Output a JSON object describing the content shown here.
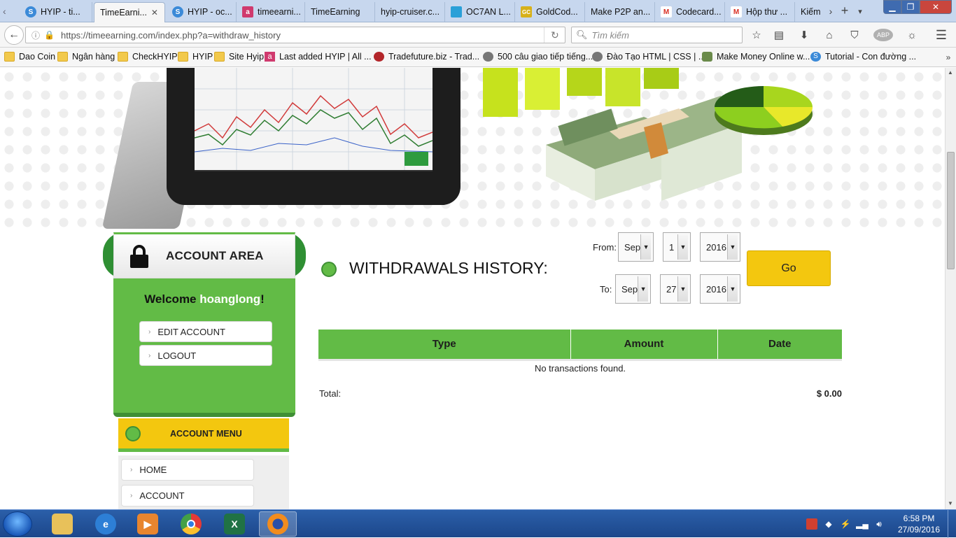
{
  "browser": {
    "tabs": [
      {
        "label": "HYIP - ti...",
        "icon": "s-circle-icon",
        "color": "#3b8ad8"
      },
      {
        "label": "TimeEarni...",
        "active": true,
        "icon": "blank-icon",
        "color": "#ffffff"
      },
      {
        "label": "HYIP - oc...",
        "icon": "s-circle-icon",
        "color": "#3b8ad8"
      },
      {
        "label": "timeearni...",
        "icon": "a-square-icon",
        "color": "#d03a6e"
      },
      {
        "label": "TimeEarning",
        "icon": "blank-icon",
        "color": "transparent"
      },
      {
        "label": "hyip-cruiser.c...",
        "icon": "blank-icon",
        "color": "transparent"
      },
      {
        "label": "OC7AN L...",
        "icon": "flag-icon",
        "color": "#2aa0d8"
      },
      {
        "label": "GoldCod...",
        "icon": "gc-icon",
        "color": "#d7b11a"
      },
      {
        "label": "Make P2P an...",
        "icon": "blank-icon",
        "color": "transparent"
      },
      {
        "label": "Codecard...",
        "icon": "gmail-icon",
        "color": "#d93025"
      },
      {
        "label": "Hộp thư ...",
        "icon": "gmail-icon",
        "color": "#d93025"
      },
      {
        "label": "Kiếm",
        "icon": "blank-icon",
        "color": "transparent"
      }
    ],
    "url": "https://timeearning.com/index.php?a=withdraw_history",
    "search_placeholder": "Tìm kiếm",
    "bookmarks": [
      {
        "label": "Dao Coin",
        "icon": "folder-icon"
      },
      {
        "label": "Ngân hàng",
        "icon": "folder-icon"
      },
      {
        "label": "CheckHYIP",
        "icon": "folder-icon"
      },
      {
        "label": "HYIP",
        "icon": "folder-icon"
      },
      {
        "label": "Site Hyip",
        "icon": "folder-icon"
      },
      {
        "label": "Last added HYIP | All ...",
        "icon": "a-square-icon"
      },
      {
        "label": "Tradefuture.biz - Trad...",
        "icon": "globe-icon"
      },
      {
        "label": "500 câu giao tiếp tiếng...",
        "icon": "globe-icon"
      },
      {
        "label": "Đào Tạo HTML | CSS | ...",
        "icon": "globe-icon"
      },
      {
        "label": "Make Money Online w...",
        "icon": "plugin-icon"
      },
      {
        "label": "Tutorial - Con đường ...",
        "icon": "s-circle-icon"
      }
    ]
  },
  "sidebar": {
    "account_title": "ACCOUNT AREA",
    "welcome_prefix": "Welcome ",
    "username": "hoanglong",
    "welcome_suffix": "!",
    "buttons": [
      "EDIT ACCOUNT",
      "LOGOUT"
    ],
    "menu_title": "ACCOUNT MENU",
    "menu_items": [
      "HOME",
      "ACCOUNT"
    ]
  },
  "main": {
    "title": "WITHDRAWALS HISTORY:",
    "from_label": "From:",
    "to_label": "To:",
    "from": {
      "month": "Sep",
      "day": "1",
      "year": "2016"
    },
    "to": {
      "month": "Sep",
      "day": "27",
      "year": "2016"
    },
    "go_label": "Go",
    "table": {
      "headers": [
        "Type",
        "Amount",
        "Date"
      ],
      "empty_message": "No transactions found."
    },
    "total_label": "Total:",
    "total_value": "$ 0.00"
  },
  "taskbar": {
    "apps": [
      "explorer-icon",
      "ie-icon",
      "media-player-icon",
      "chrome-icon",
      "excel-icon",
      "firefox-icon"
    ],
    "time": "6:58 PM",
    "date": "27/09/2016"
  },
  "colors": {
    "brand_green": "#62bb46",
    "brand_yellow": "#f3c70f"
  }
}
